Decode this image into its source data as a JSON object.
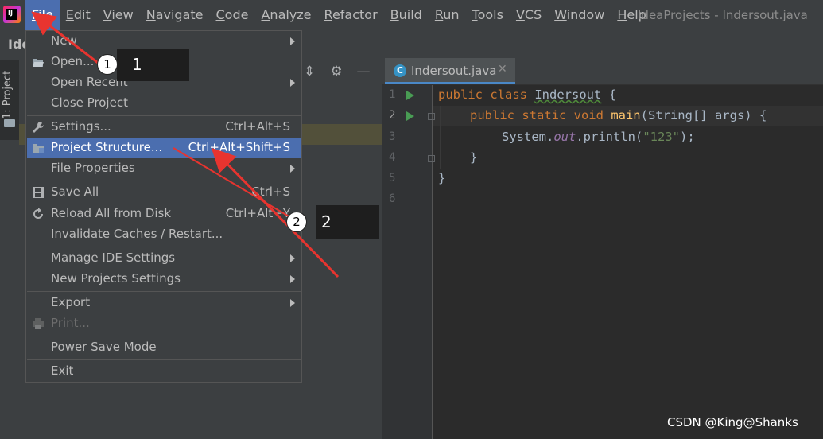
{
  "app": {
    "window_title": "IdeaProjects - Indersout.java",
    "breadcrumb": "Ide",
    "logo_text": "IJ"
  },
  "menubar": {
    "items": [
      "File",
      "Edit",
      "View",
      "Navigate",
      "Code",
      "Analyze",
      "Refactor",
      "Build",
      "Run",
      "Tools",
      "VCS",
      "Window",
      "Help"
    ],
    "active": "File"
  },
  "sidebar": {
    "project_tab": "1: Project"
  },
  "file_menu": {
    "items": [
      {
        "label": "New",
        "shortcut": "",
        "submenu": true
      },
      {
        "label": "Open...",
        "shortcut": "",
        "submenu": false
      },
      {
        "label": "Open Recent",
        "shortcut": "",
        "submenu": true
      },
      {
        "label": "Close Project",
        "shortcut": "",
        "submenu": false
      },
      {
        "label": "Settings...",
        "shortcut": "Ctrl+Alt+S",
        "submenu": false
      },
      {
        "label": "Project Structure...",
        "shortcut": "Ctrl+Alt+Shift+S",
        "submenu": false
      },
      {
        "label": "File Properties",
        "shortcut": "",
        "submenu": true
      },
      {
        "label": "Save All",
        "shortcut": "Ctrl+S",
        "submenu": false
      },
      {
        "label": "Reload All from Disk",
        "shortcut": "Ctrl+Alt+Y",
        "submenu": false
      },
      {
        "label": "Invalidate Caches / Restart...",
        "shortcut": "",
        "submenu": false
      },
      {
        "label": "Manage IDE Settings",
        "shortcut": "",
        "submenu": true
      },
      {
        "label": "New Projects Settings",
        "shortcut": "",
        "submenu": true
      },
      {
        "label": "Export",
        "shortcut": "",
        "submenu": true
      },
      {
        "label": "Print...",
        "shortcut": "",
        "submenu": false
      },
      {
        "label": "Power Save Mode",
        "shortcut": "",
        "submenu": false
      },
      {
        "label": "Exit",
        "shortcut": "",
        "submenu": false
      }
    ],
    "selected": "Project Structure...",
    "disabled": [
      "Print..."
    ]
  },
  "editor": {
    "tab_label": "Indersout.java",
    "tab_icon": "C",
    "line_numbers": [
      "1",
      "2",
      "3",
      "4",
      "5",
      "6"
    ],
    "code": {
      "l1_kw": "public class ",
      "l1_cls": "Indersout",
      "l1_rest": " {",
      "l2_kw": "public static void ",
      "l2_fn": "main",
      "l2_rest": "(String[] args) {",
      "l3_a": "System.",
      "l3_fld": "out",
      "l3_b": ".println(",
      "l3_str": "\"123\"",
      "l3_c": ");",
      "l4": "}",
      "l5": "}"
    }
  },
  "annotations": {
    "step1": "1",
    "step2": "2",
    "arrow_color": "#e8342f"
  },
  "watermark": "CSDN @King@Shanks",
  "icons": [
    "folder-open-icon",
    "wrench-icon",
    "project-structure-icon",
    "save-icon",
    "reload-icon",
    "print-icon",
    "gear-icon",
    "minimize-icon",
    "collapse-icon"
  ]
}
